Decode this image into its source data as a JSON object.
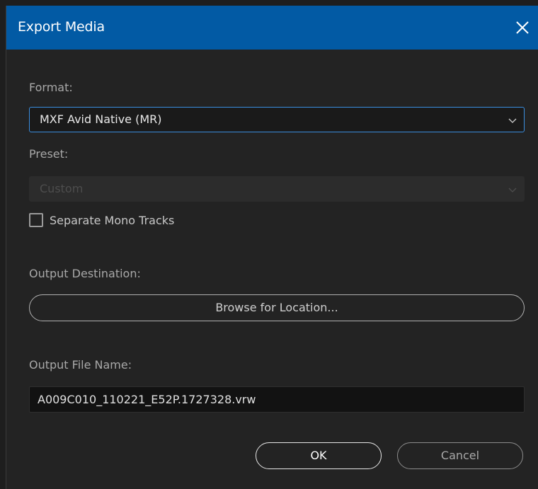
{
  "window": {
    "title": "Export Media",
    "close_icon": "close-icon",
    "titlebar_color": "#025aa4",
    "background_color": "#232323"
  },
  "format": {
    "label": "Format:",
    "selected": "MXF Avid Native (MR)",
    "accent_color": "#3b8fe0"
  },
  "preset": {
    "label": "Preset:",
    "selected": "Custom",
    "disabled": true
  },
  "mono_tracks": {
    "label": "Separate Mono Tracks",
    "checked": false
  },
  "destination": {
    "label": "Output Destination:",
    "browse_label": "Browse for Location..."
  },
  "filename": {
    "label": "Output File Name:",
    "value": "A009C010_110221_E52P.1727328.vrw"
  },
  "footer": {
    "ok_label": "OK",
    "cancel_label": "Cancel"
  }
}
